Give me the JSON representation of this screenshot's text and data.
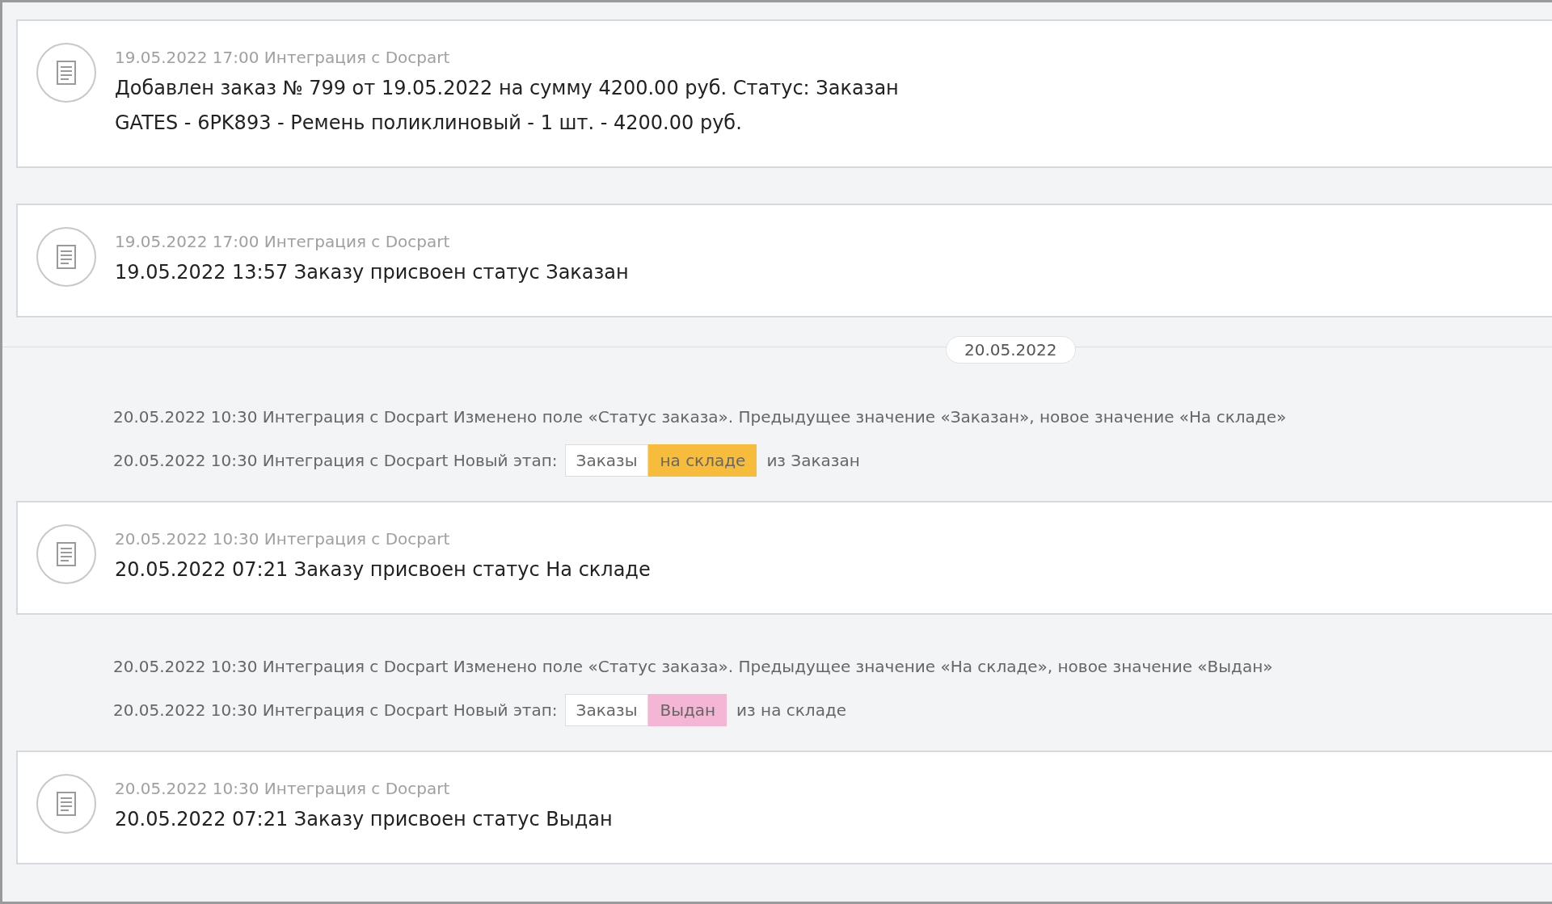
{
  "timeline": [
    {
      "kind": "card",
      "meta": "19.05.2022 17:00 Интеграция с Docpart",
      "lines": [
        "Добавлен заказ № 799 от 19.05.2022 на сумму 4200.00 руб. Статус: Заказан",
        "GATES - 6PK893 - Ремень поликлиновый - 1 шт. - 4200.00 руб."
      ]
    },
    {
      "kind": "card",
      "meta": "19.05.2022 17:00 Интеграция с Docpart",
      "lines": [
        "19.05.2022 13:57 Заказу присвоен статус Заказан"
      ]
    },
    {
      "kind": "date",
      "label": "20.05.2022"
    },
    {
      "kind": "note",
      "text": "20.05.2022 10:30 Интеграция с Docpart Изменено поле «Статус заказа». Предыдущее значение «Заказан», новое значение «На складе»"
    },
    {
      "kind": "stage",
      "text": "20.05.2022 10:30 Интеграция с Docpart Новый этап:",
      "pipeline": "Заказы",
      "stage": "на складе",
      "color": "#f7bc3c",
      "from": "из Заказан"
    },
    {
      "kind": "card",
      "meta": "20.05.2022 10:30 Интеграция с Docpart",
      "lines": [
        "20.05.2022 07:21 Заказу присвоен статус На складе"
      ]
    },
    {
      "kind": "note",
      "text": "20.05.2022 10:30 Интеграция с Docpart Изменено поле «Статус заказа». Предыдущее значение «На складе», новое значение «Выдан»"
    },
    {
      "kind": "stage",
      "text": "20.05.2022 10:30 Интеграция с Docpart Новый этап:",
      "pipeline": "Заказы",
      "stage": "Выдан",
      "color": "#f5b5d5",
      "from": "из на складе"
    },
    {
      "kind": "card",
      "meta": "20.05.2022 10:30 Интеграция с Docpart",
      "lines": [
        "20.05.2022 07:21 Заказу присвоен статус Выдан"
      ]
    }
  ]
}
